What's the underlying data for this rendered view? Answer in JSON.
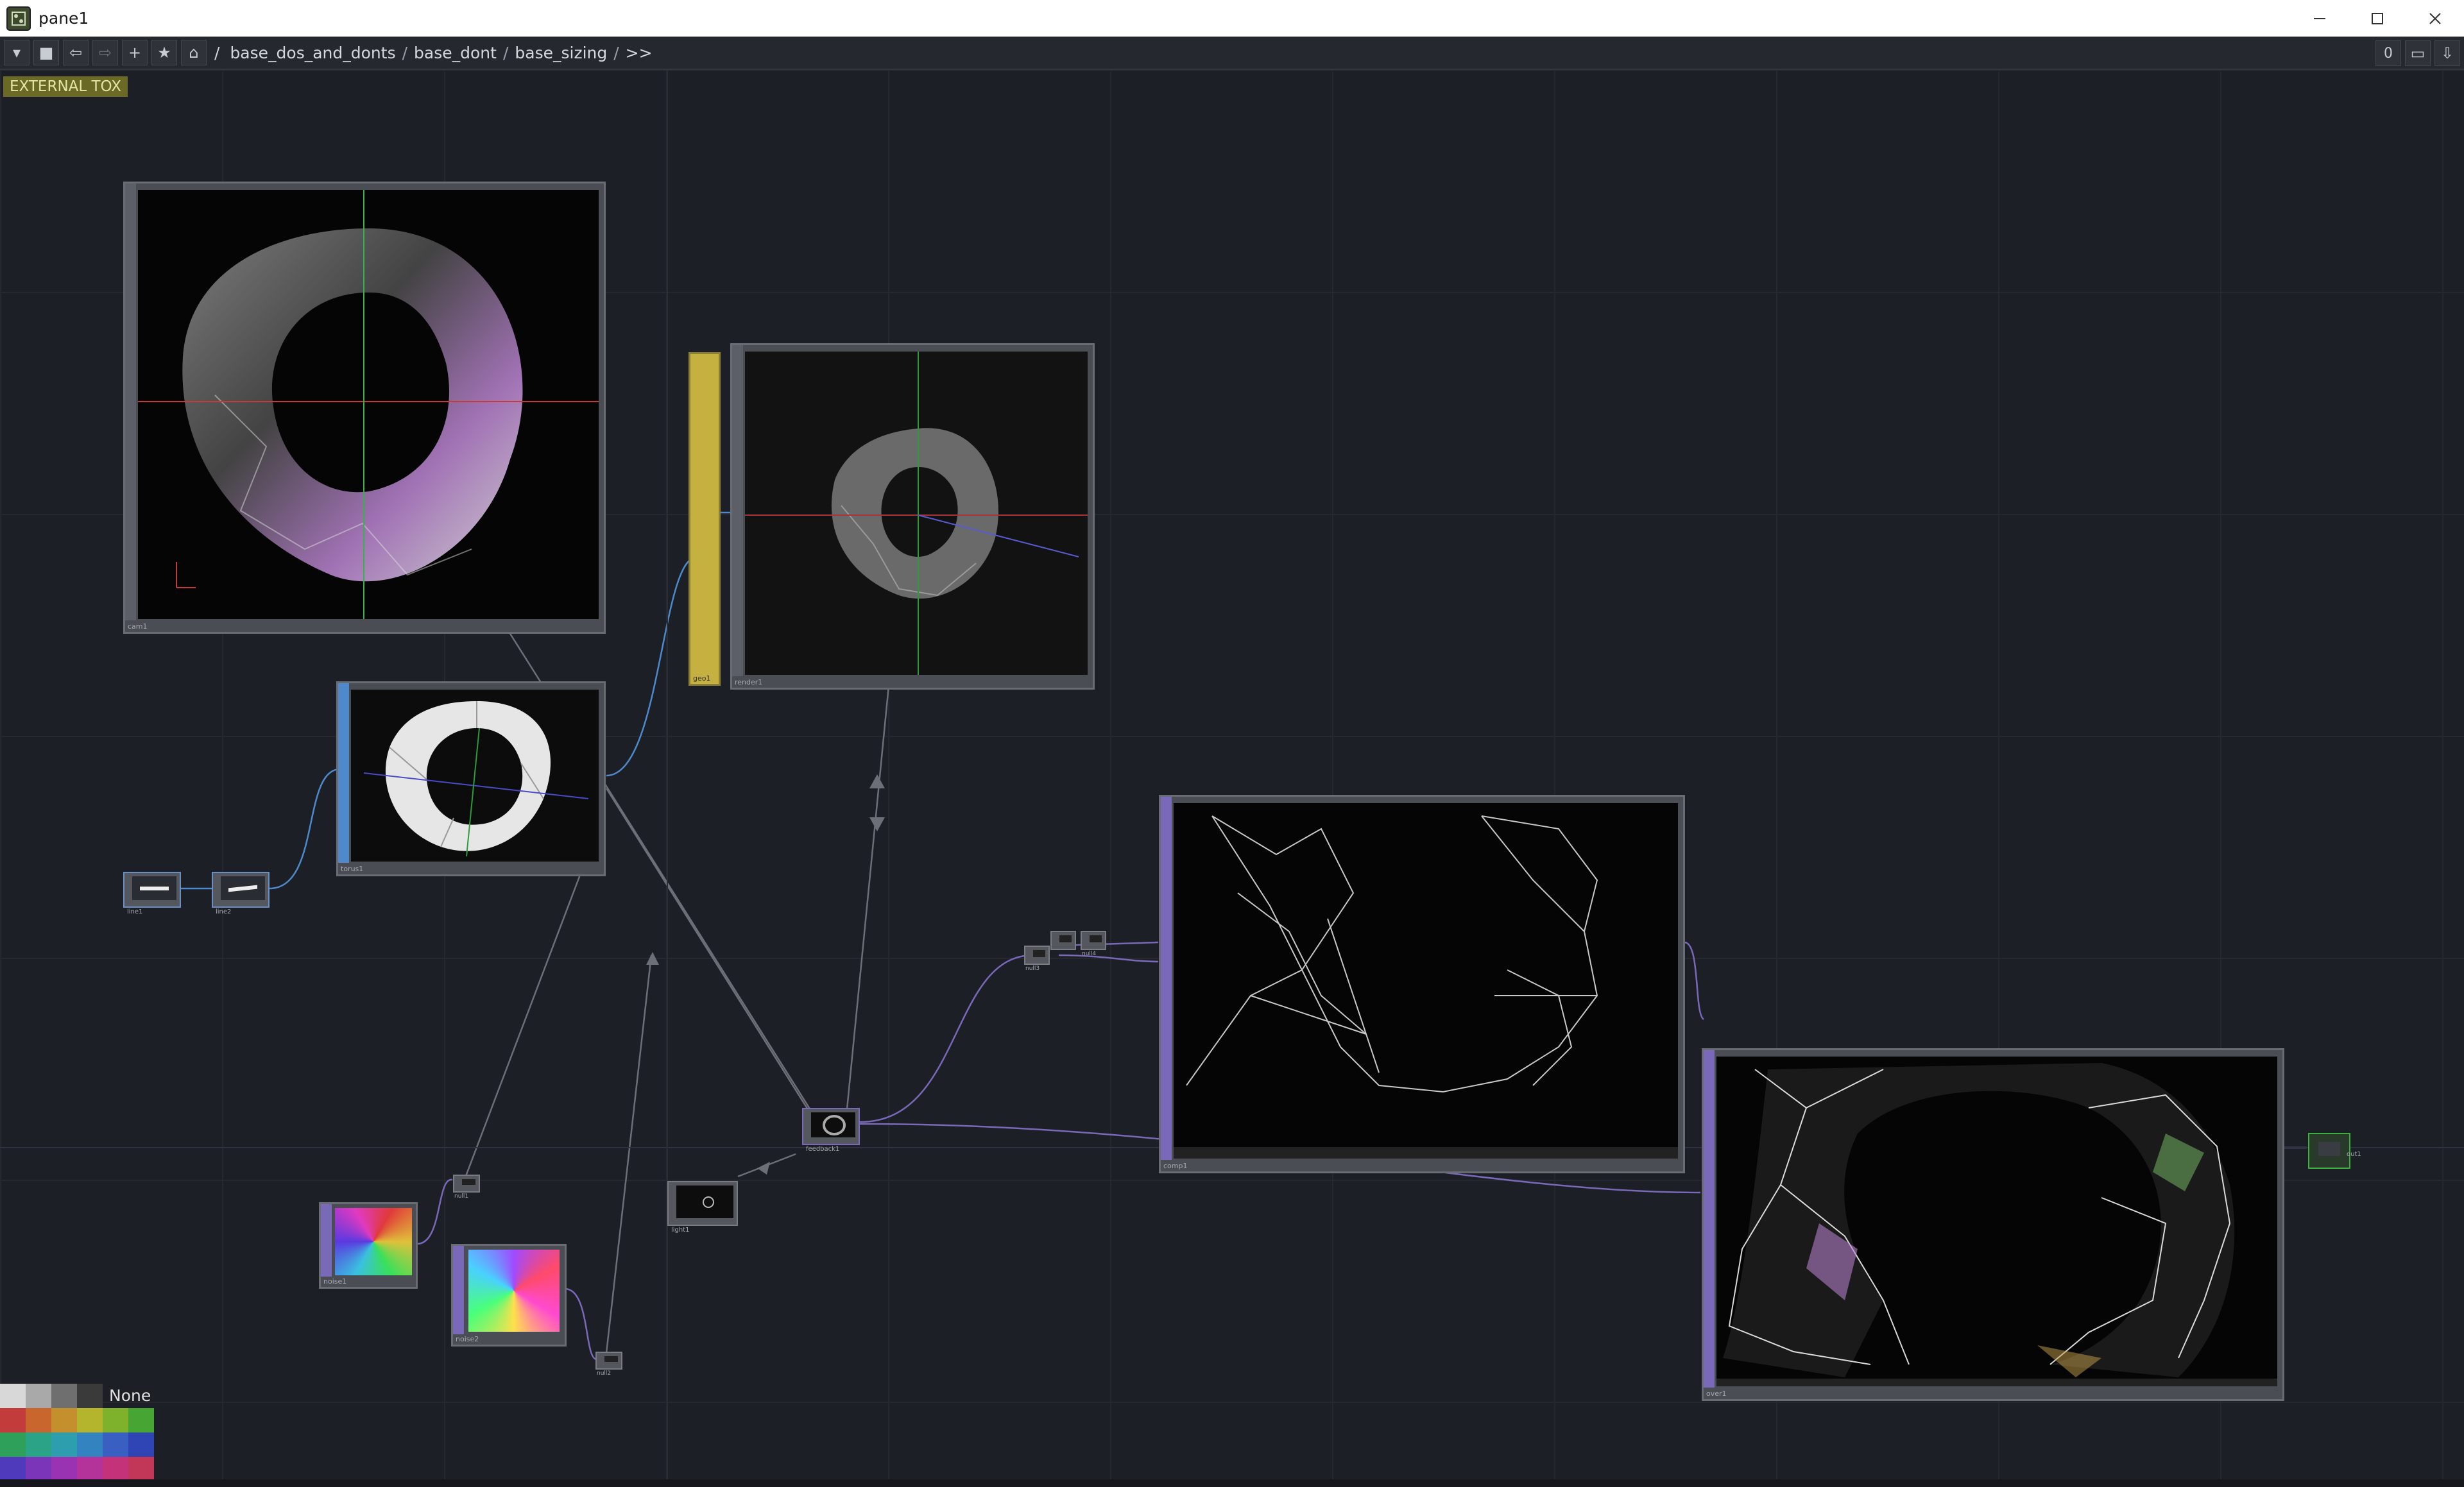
{
  "window": {
    "title": "pane1",
    "controls": [
      "minimize",
      "maximize",
      "close"
    ]
  },
  "toolbar": {
    "buttons": [
      "menu-dropdown",
      "stop",
      "back",
      "forward",
      "add",
      "bookmark",
      "home"
    ],
    "breadcrumbs": [
      "/",
      "base_dos_and_donts",
      "/",
      "base_dont",
      "/",
      "base_sizing",
      "/",
      ">>"
    ],
    "counter": "0"
  },
  "network": {
    "badge": "EXTERNAL TOX",
    "nodes": {
      "cam1": "cam1",
      "render1": "render1",
      "geo1": "geo1",
      "torus1": "torus1",
      "line1": "line1",
      "line2": "line2",
      "comp1": "comp1",
      "over1": "over1",
      "noise1": "noise1",
      "noise2": "noise2",
      "null1": "null1",
      "null2": "null2",
      "light1": "light1",
      "feedback1": "feedback1",
      "null3": "null3",
      "null4": "null4",
      "out1": "out1"
    }
  },
  "palette": {
    "none_label": "None",
    "colors": [
      [
        "#d8d8d8",
        "#a9a9a9",
        "#6f6f6f",
        "#3a3a3a"
      ],
      [
        "#c23c3c",
        "#c9662e",
        "#c48f2d",
        "#b4b42d",
        "#7fb22c",
        "#47a533"
      ],
      [
        "#2fa05a",
        "#2aa387",
        "#2d9eae",
        "#3383c0",
        "#3a5fc2",
        "#2f44b5"
      ],
      [
        "#4e3aba",
        "#7a35b8",
        "#9a33b1",
        "#b4339b",
        "#c4337a",
        "#c23658"
      ]
    ]
  },
  "colors": {
    "background": "#1d1f26",
    "sop_flag": "#4e8acb",
    "top_flag": "#7a68b8",
    "comp_flag": "#c4b13f",
    "out_green": "#3bb03b"
  }
}
